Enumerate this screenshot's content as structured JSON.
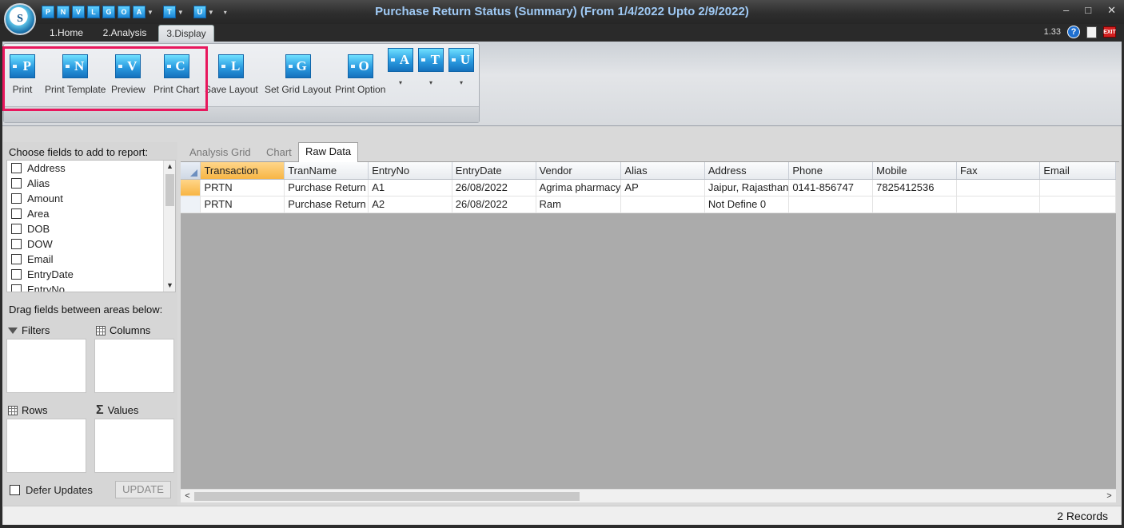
{
  "window": {
    "title": "Purchase Return Status (Summary)  (From 1/4/2022 Upto 2/9/2022)",
    "logo_letter": "S",
    "version": "1.33",
    "help_glyph": "?",
    "exit_label": "EXIT",
    "minimize_glyph": "–",
    "maximize_glyph": "□",
    "close_glyph": "✕"
  },
  "quick_access": [
    {
      "letter": "P"
    },
    {
      "letter": "N"
    },
    {
      "letter": "V"
    },
    {
      "letter": "L"
    },
    {
      "letter": "G"
    },
    {
      "letter": "O"
    },
    {
      "letter": "A"
    },
    {
      "letter": "T"
    },
    {
      "letter": "U"
    }
  ],
  "ribbon_tabs": [
    "1.Home",
    "2.Analysis",
    "3.Display"
  ],
  "ribbon": {
    "buttons": [
      {
        "letter": "P",
        "label": "Print"
      },
      {
        "letter": "N",
        "label": "Print Template"
      },
      {
        "letter": "V",
        "label": "Preview"
      },
      {
        "letter": "C",
        "label": "Print Chart"
      },
      {
        "letter": "L",
        "label": "Save Layout"
      },
      {
        "letter": "G",
        "label": "Set Grid Layout"
      },
      {
        "letter": "O",
        "label": "Print Option"
      },
      {
        "letter": "A",
        "label": ""
      },
      {
        "letter": "T",
        "label": ""
      },
      {
        "letter": "U",
        "label": ""
      }
    ],
    "caret": "▾"
  },
  "field_chooser": {
    "heading": "Choose fields to add to report:",
    "fields": [
      "Address",
      "Alias",
      "Amount",
      "Area",
      "DOB",
      "DOW",
      "Email",
      "EntryDate",
      "EntryNo"
    ],
    "drag_heading": "Drag fields between areas below:",
    "areas": {
      "filters": "Filters",
      "columns": "Columns",
      "rows": "Rows",
      "values": "Values"
    },
    "defer_label": "Defer Updates",
    "update_label": "UPDATE"
  },
  "display_tabs": [
    "Analysis Grid",
    "Chart",
    "Raw Data"
  ],
  "grid": {
    "columns": [
      "Transaction",
      "TranName",
      "EntryNo",
      "EntryDate",
      "Vendor",
      "Alias",
      "Address",
      "Phone",
      "Mobile",
      "Fax",
      "Email"
    ],
    "rows": [
      [
        "PRTN",
        "Purchase Return",
        "A1",
        "26/08/2022",
        "Agrima pharmacy",
        "AP",
        "Jaipur, Rajasthan",
        "0141-856747",
        "7825412536",
        "",
        ""
      ],
      [
        "PRTN",
        "Purchase Return",
        "A2",
        "26/08/2022",
        "Ram",
        "",
        " Not Define 0",
        "",
        "",
        "",
        ""
      ]
    ]
  },
  "status": {
    "records": "2 Records"
  },
  "colors": {
    "accent": "#e8175d",
    "selected_header": "#f7b545",
    "title_text": "#9fc9f4"
  }
}
